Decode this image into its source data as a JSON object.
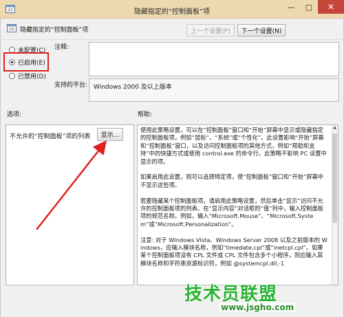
{
  "window": {
    "title": "隐藏指定的“控制面板”项",
    "minimize_glyph": "—",
    "maximize_glyph": "▢",
    "close_glyph": "✕"
  },
  "header": {
    "setting_name": "隐藏指定的“控制面板”项",
    "prev_button": "上一个设置(P)",
    "next_button": "下一个设置(N)"
  },
  "state": {
    "not_configured": "未配置(C)",
    "enabled": "已启用(E)",
    "disabled": "已禁用(D)",
    "selected": "enabled"
  },
  "comment": {
    "label": "注释:",
    "value": ""
  },
  "supported_on": {
    "label": "支持的平台:",
    "value": "Windows 2000 及以上版本"
  },
  "options": {
    "label": "选项:",
    "list_label": "不允许的“控制面板”项的列表",
    "show_button": "显示..."
  },
  "help": {
    "label": "帮助:",
    "paragraphs": [
      "使用此策略设置，可以在“控制面板”窗口和“开始”屏幕中显示或隐藏指定的控制面板项，例如“鼠标”、“系统”或“个性化”。此设置影响“开始”屏幕和“控制面板”窗口，以及访问控制面板项的其他方式，例如“帮助和支持”中的快捷方式或使用 control.exe 的命令行。此策略不影响 PC 设置中显示的项。",
      "如果启用此设置，则可以选择特定项，使“控制面板”窗口和“开始”屏幕中不显示这些项。",
      "若要隐藏某个控制面板项，请启用此策略设置，然后单击“显示”访问不允许的控制面板项的列表。在“显示内容”对话框的“值”列中，输入控制面板项的规范名称。例如，输入“Microsoft.Mouse”、“Microsoft.System”或“Microsoft.Personalization”。",
      "注意: 对于 Windows Vista、Windows Server 2008 以及之前版本的 Windows，应输入模块名称，例如“timedate.cpl”或“inetcpl.cpl”。如果某个控制面板项没有 CPL 文件或 CPL 文件包含多个小程序，则应输入其模块名称和字符串资源标识符，例如 @systemcpl.dll,-1"
    ]
  },
  "watermark": {
    "logo": "技术员联盟",
    "url": "www.jsgho.com"
  },
  "colors": {
    "titlebar": "#ecd9b0",
    "highlight_box": "#e02020",
    "arrow": "#e02020",
    "watermark": "#2ab332"
  }
}
